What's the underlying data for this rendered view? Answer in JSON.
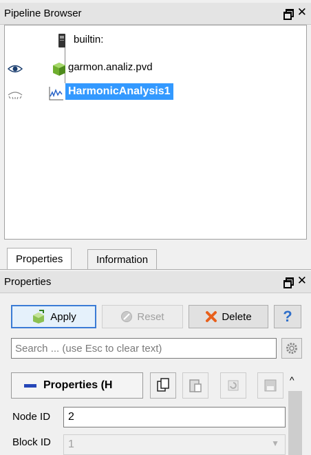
{
  "pipeline_dock": {
    "title": "Pipeline Browser",
    "float_icon": "float-window-icon",
    "close_icon": "close-icon",
    "items": [
      {
        "label": "builtin:",
        "icon": "server-icon",
        "visible": null,
        "selected": false
      },
      {
        "label": "garmon.analiz.pvd",
        "icon": "dataset-cube-icon",
        "visible": true,
        "selected": false
      },
      {
        "label": "HarmonicAnalysis1",
        "icon": "plot-line-icon",
        "visible": false,
        "selected": true
      }
    ]
  },
  "tabs": [
    {
      "label": "Properties",
      "active": true
    },
    {
      "label": "Information",
      "active": false
    }
  ],
  "properties_dock": {
    "title": "Properties",
    "apply_label": "Apply",
    "reset_label": "Reset",
    "delete_label": "Delete",
    "help_label": "?",
    "search_placeholder": "Search ... (use Esc to clear text)",
    "section_label": "Properties (H",
    "node_id_label": "Node ID",
    "node_id_value": "2",
    "block_id_label": "Block ID",
    "block_id_value": "1"
  },
  "colors": {
    "selection": "#3399ff",
    "accent": "#3a7bd5"
  }
}
